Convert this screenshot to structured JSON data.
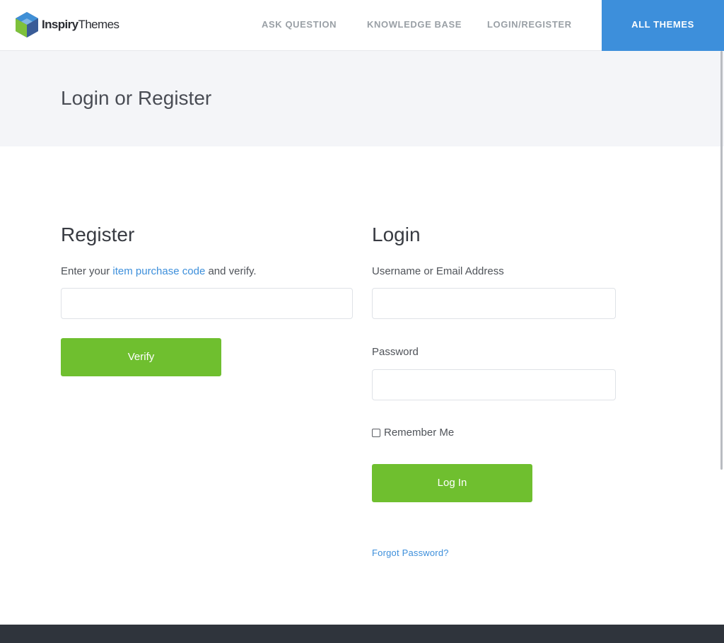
{
  "header": {
    "logo": {
      "brand_bold": "Inspiry",
      "brand_light": "Themes",
      "icon": "cube-logo-icon"
    },
    "nav": [
      {
        "label": "ASK QUESTION"
      },
      {
        "label": "KNOWLEDGE BASE"
      },
      {
        "label": "LOGIN/REGISTER"
      }
    ],
    "cta": {
      "label": "ALL THEMES"
    }
  },
  "page": {
    "title": "Login or Register"
  },
  "register": {
    "heading": "Register",
    "desc_before": "Enter your ",
    "desc_link": "item purchase code",
    "desc_after": " and verify.",
    "code_input": {
      "value": "",
      "placeholder": ""
    },
    "verify_label": "Verify"
  },
  "login": {
    "heading": "Login",
    "username_label": "Username or Email Address",
    "username_input": {
      "value": "",
      "placeholder": ""
    },
    "password_label": "Password",
    "password_input": {
      "value": "",
      "placeholder": ""
    },
    "remember_label": "Remember Me",
    "remember_checked": false,
    "login_label": "Log In",
    "forgot_label": "Forgot Password?"
  },
  "colors": {
    "accent_blue": "#3d8fdb",
    "button_green": "#6fbf2f",
    "title_band": "#f4f5f8",
    "footer": "#2f343c"
  }
}
